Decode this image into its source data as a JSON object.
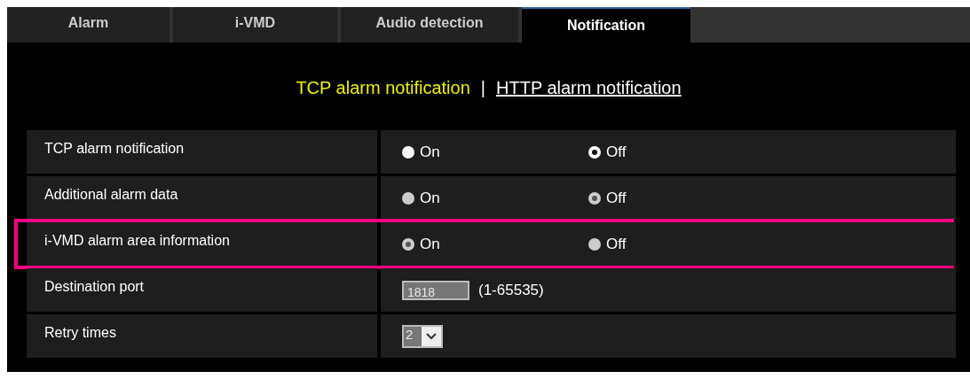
{
  "tabs": [
    {
      "label": "Alarm",
      "selected": false
    },
    {
      "label": "i-VMD",
      "selected": false
    },
    {
      "label": "Audio detection",
      "selected": false
    },
    {
      "label": "Notification",
      "selected": true
    }
  ],
  "subnav": [
    {
      "label": "TCP alarm notification",
      "selected": true
    },
    {
      "label": "HTTP alarm notification",
      "selected": false
    }
  ],
  "subnav_separator": "|",
  "rows": [
    {
      "kind": "radio",
      "label": "TCP alarm notification",
      "disabled": false,
      "highlighted": false,
      "options": [
        {
          "label": "On",
          "selected": false
        },
        {
          "label": "Off",
          "selected": true
        }
      ]
    },
    {
      "kind": "radio",
      "label": "Additional alarm data",
      "disabled": true,
      "highlighted": false,
      "options": [
        {
          "label": "On",
          "selected": false
        },
        {
          "label": "Off",
          "selected": true
        }
      ]
    },
    {
      "kind": "radio",
      "label": "i-VMD alarm area information",
      "disabled": true,
      "highlighted": true,
      "options": [
        {
          "label": "On",
          "selected": true
        },
        {
          "label": "Off",
          "selected": false
        }
      ]
    },
    {
      "kind": "input",
      "label": "Destination port",
      "disabled": true,
      "highlighted": false,
      "value": "1818",
      "hint": "(1-65535)"
    },
    {
      "kind": "select",
      "label": "Retry times",
      "disabled": true,
      "highlighted": false,
      "value": "2"
    }
  ]
}
